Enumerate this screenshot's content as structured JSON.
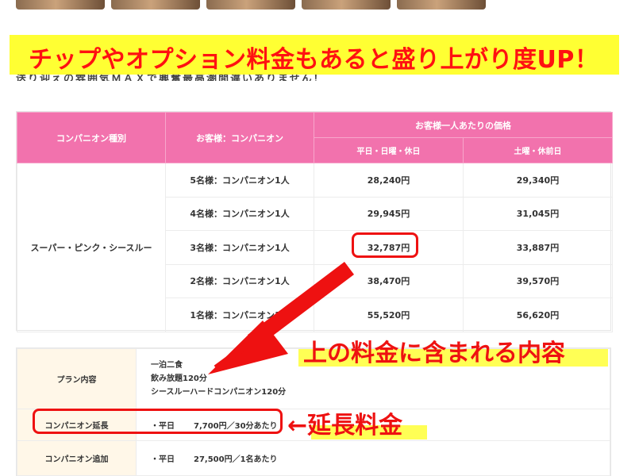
{
  "banner": {
    "headline": "チップやオプション料金もあると盛り上がり度UP！",
    "subline": "送り迎えの雰囲気ＭＡＸで興奮最高潮間違いありません！"
  },
  "price_table": {
    "col_type": "コンパニオン種別",
    "col_ratio": "お客様：コンパニオン",
    "col_price_group": "お客様一人あたりの価格",
    "col_weekday": "平日・日曜・休日",
    "col_saturday": "土曜・休前日",
    "type_label": "スーパー・ピンク・シースルー",
    "rows": [
      {
        "ratio": "5名様：コンパニオン1人",
        "weekday": "28,240円",
        "saturday": "29,340円"
      },
      {
        "ratio": "4名様：コンパニオン1人",
        "weekday": "29,945円",
        "saturday": "31,045円"
      },
      {
        "ratio": "3名様：コンパニオン1人",
        "weekday": "32,787円",
        "saturday": "33,887円"
      },
      {
        "ratio": "2名様：コンパニオン1人",
        "weekday": "38,470円",
        "saturday": "39,570円"
      },
      {
        "ratio": "1名様：コンパニオン1人",
        "weekday": "55,520円",
        "saturday": "56,620円"
      }
    ]
  },
  "plan_table": {
    "plan_label": "プラン内容",
    "plan_lines": [
      "一泊二食",
      "飲み放題120分",
      "シースルーハードコンパニオン120分"
    ],
    "extend_label": "コンパニオン延長",
    "extend_day": "・平日",
    "extend_price": "7,700円／30分あたり",
    "add_label": "コンパニオン追加",
    "add_day": "・平日",
    "add_price": "27,500円／1名あたり"
  },
  "annotations": {
    "included_note": "上の料金に含まれる内容",
    "extension_note": "←延長料金",
    "accent_color": "#ee1111",
    "highlight_color": "#ffff33"
  }
}
